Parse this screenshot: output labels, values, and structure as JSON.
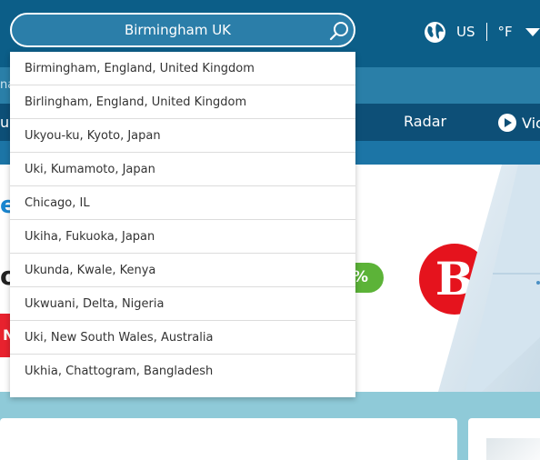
{
  "search": {
    "value": "Birmingham UK",
    "suggestions": [
      "Birmingham, England, United Kingdom",
      "Birlingham, England, United Kingdom",
      "Ukyou-ku, Kyoto, Japan",
      "Uki, Kumamoto, Japan",
      "Chicago, IL",
      "Ukiha, Fukuoka, Japan",
      "Ukunda, Kwale, Kenya",
      "Ukwuani, Delta, Nigeria",
      "Uki, New South Wales, Australia",
      "Ukhia, Chattogram, Bangladesh"
    ]
  },
  "header": {
    "unit_country": "US",
    "unit_temp": "°F"
  },
  "strip": {
    "partial_text": "na"
  },
  "nav": {
    "partial_left": "u",
    "radar": "Radar",
    "video": "Vic"
  },
  "banner": {
    "blue_fragment": "e",
    "dark_fragment": "o",
    "red_fragment": "N",
    "percent_fragment": "%"
  },
  "colors": {
    "header_bg": "#0c5e88",
    "nav_bg": "#0d4f77",
    "brand_red": "#e5131d",
    "badge_green": "#5cb338",
    "page_bg": "#8fcad8"
  }
}
